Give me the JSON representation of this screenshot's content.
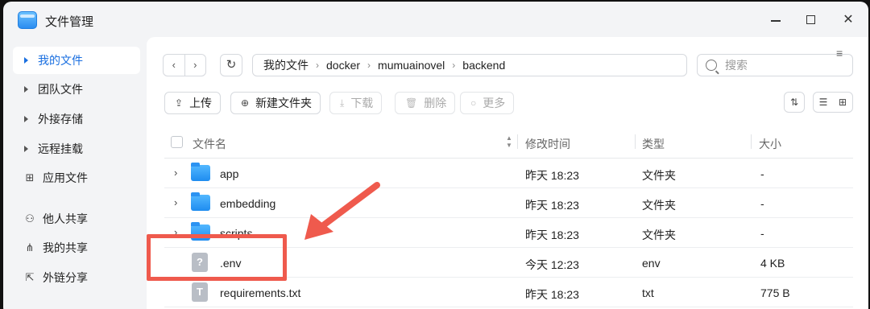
{
  "window": {
    "title": "文件管理"
  },
  "sidebar": {
    "items": [
      {
        "label": "我的文件",
        "icon": "caret-right-icon",
        "active": true
      },
      {
        "label": "团队文件",
        "icon": "caret-right-icon"
      },
      {
        "label": "外接存储",
        "icon": "caret-right-icon"
      },
      {
        "label": "远程挂载",
        "icon": "caret-right-icon"
      },
      {
        "label": "应用文件",
        "icon": "app-grid-icon"
      },
      {
        "label": "他人共享",
        "icon": "users-icon"
      },
      {
        "label": "我的共享",
        "icon": "share-icon"
      },
      {
        "label": "外链分享",
        "icon": "external-link-icon"
      }
    ]
  },
  "breadcrumb": [
    "我的文件",
    "docker",
    "mumuainovel",
    "backend"
  ],
  "search": {
    "placeholder": "搜索"
  },
  "toolbar": {
    "upload": "上传",
    "new_folder": "新建文件夹",
    "download": "下载",
    "delete": "删除",
    "more": "更多"
  },
  "table": {
    "columns": [
      "文件名",
      "修改时间",
      "类型",
      "大小"
    ],
    "rows": [
      {
        "name": "app",
        "modified": "昨天 18:23",
        "type": "文件夹",
        "size": "-",
        "kind": "folder"
      },
      {
        "name": "embedding",
        "modified": "昨天 18:23",
        "type": "文件夹",
        "size": "-",
        "kind": "folder"
      },
      {
        "name": "scripts",
        "modified": "昨天 18:23",
        "type": "文件夹",
        "size": "-",
        "kind": "folder"
      },
      {
        "name": ".env",
        "modified": "今天 12:23",
        "type": "env",
        "size": "4 KB",
        "kind": "unknown-file",
        "icon_glyph": "?"
      },
      {
        "name": "requirements.txt",
        "modified": "昨天 18:23",
        "type": "txt",
        "size": "775 B",
        "kind": "text-file",
        "icon_glyph": "T"
      }
    ]
  },
  "annotation": {
    "color": "#ef5a4d",
    "target": ".env"
  }
}
